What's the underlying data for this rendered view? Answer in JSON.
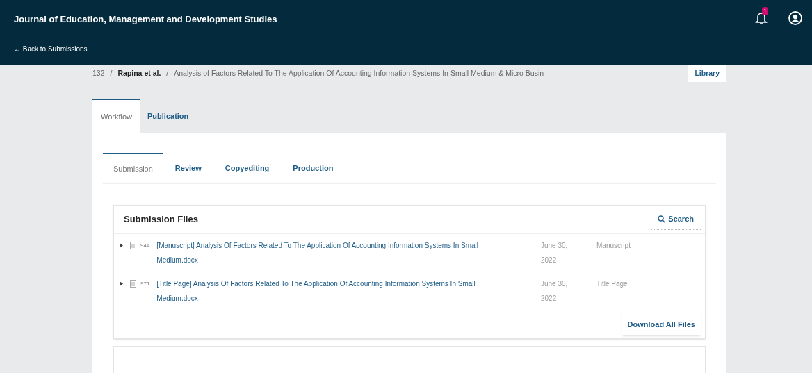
{
  "header": {
    "title": "Journal of Education, Management and Development Studies",
    "back_link": "← Back to Submissions",
    "notification_count": "1"
  },
  "breadcrumb": {
    "id": "132",
    "separator": "/",
    "authors": "Rapina et al.",
    "title": "Analysis of Factors Related To The Application Of Accounting Information Systems In Small Medium & Micro Busin",
    "library_button": "Library"
  },
  "tabs": [
    {
      "label": "Workflow",
      "selected": true
    },
    {
      "label": "Publication",
      "selected": false
    }
  ],
  "subtabs": [
    {
      "label": "Submission",
      "selected": true
    },
    {
      "label": "Review",
      "selected": false
    },
    {
      "label": "Copyediting",
      "selected": false
    },
    {
      "label": "Production",
      "selected": false
    }
  ],
  "submission_files": {
    "title": "Submission Files",
    "search_button": "Search",
    "download_button": "Download All Files",
    "rows": [
      {
        "id": "944",
        "name": "[Manuscript] Analysis Of Factors Related To The Application Of Accounting Information Systems In Small Medium.docx",
        "date": "June 30, 2022",
        "component": "Manuscript"
      },
      {
        "id": "971",
        "name": "[Title Page] Analysis Of Factors Related To The Application Of Accounting Information Systems In Small Medium.docx",
        "date": "June 30, 2022",
        "component": "Title Page"
      }
    ]
  }
}
